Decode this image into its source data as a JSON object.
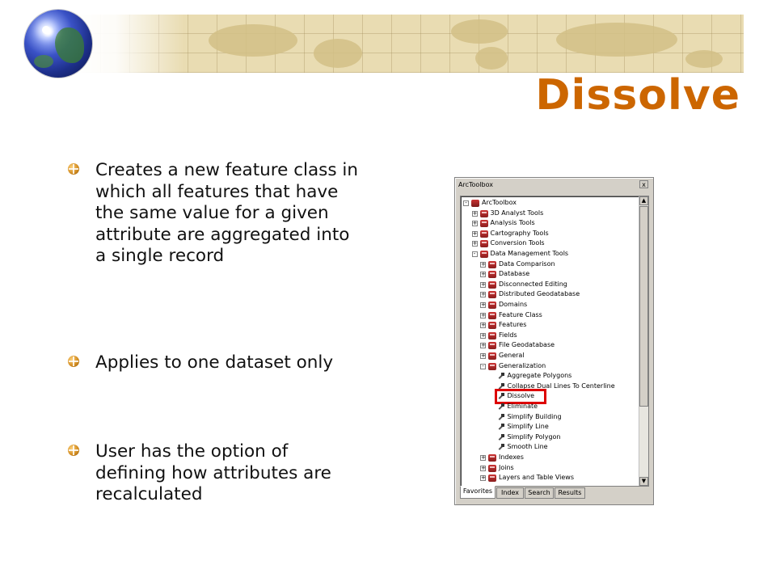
{
  "slide": {
    "title": "Dissolve",
    "bullets": [
      "Creates a new feature class in which all features that have the same value for a given attribute are aggregated into a single record",
      "Applies to one dataset only",
      "User has the option of defining how attributes are recalculated"
    ]
  },
  "window": {
    "title": "ArcToolbox",
    "close_label": "x",
    "tree": [
      {
        "label": "ArcToolbox",
        "level": 0,
        "icon": "toolbox-root-icon",
        "expander": "-"
      },
      {
        "label": "3D Analyst Tools",
        "level": 1,
        "icon": "toolbox-icon",
        "expander": "+"
      },
      {
        "label": "Analysis Tools",
        "level": 1,
        "icon": "toolbox-icon",
        "expander": "+"
      },
      {
        "label": "Cartography Tools",
        "level": 1,
        "icon": "toolbox-icon",
        "expander": "+"
      },
      {
        "label": "Conversion Tools",
        "level": 1,
        "icon": "toolbox-icon",
        "expander": "+"
      },
      {
        "label": "Data Management Tools",
        "level": 1,
        "icon": "toolbox-icon",
        "expander": "-"
      },
      {
        "label": "Data Comparison",
        "level": 2,
        "icon": "toolset-icon",
        "expander": "+"
      },
      {
        "label": "Database",
        "level": 2,
        "icon": "toolset-icon",
        "expander": "+"
      },
      {
        "label": "Disconnected Editing",
        "level": 2,
        "icon": "toolset-icon",
        "expander": "+"
      },
      {
        "label": "Distributed Geodatabase",
        "level": 2,
        "icon": "toolset-icon",
        "expander": "+"
      },
      {
        "label": "Domains",
        "level": 2,
        "icon": "toolset-icon",
        "expander": "+"
      },
      {
        "label": "Feature Class",
        "level": 2,
        "icon": "toolset-icon",
        "expander": "+"
      },
      {
        "label": "Features",
        "level": 2,
        "icon": "toolset-icon",
        "expander": "+"
      },
      {
        "label": "Fields",
        "level": 2,
        "icon": "toolset-icon",
        "expander": "+"
      },
      {
        "label": "File Geodatabase",
        "level": 2,
        "icon": "toolset-icon",
        "expander": "+"
      },
      {
        "label": "General",
        "level": 2,
        "icon": "toolset-icon",
        "expander": "+"
      },
      {
        "label": "Generalization",
        "level": 2,
        "icon": "toolset-icon",
        "expander": "-"
      },
      {
        "label": "Aggregate Polygons",
        "level": 3,
        "icon": "tool-hammer-icon",
        "expander": ""
      },
      {
        "label": "Collapse Dual Lines To Centerline",
        "level": 3,
        "icon": "tool-hammer-icon",
        "expander": ""
      },
      {
        "label": "Dissolve",
        "level": 3,
        "icon": "tool-hammer-icon",
        "expander": ""
      },
      {
        "label": "Eliminate",
        "level": 3,
        "icon": "tool-hammer-icon",
        "expander": ""
      },
      {
        "label": "Simplify Building",
        "level": 3,
        "icon": "tool-hammer-icon",
        "expander": ""
      },
      {
        "label": "Simplify Line",
        "level": 3,
        "icon": "tool-hammer-icon",
        "expander": ""
      },
      {
        "label": "Simplify Polygon",
        "level": 3,
        "icon": "tool-hammer-icon",
        "expander": ""
      },
      {
        "label": "Smooth Line",
        "level": 3,
        "icon": "tool-hammer-icon",
        "expander": ""
      },
      {
        "label": "Indexes",
        "level": 2,
        "icon": "toolset-icon",
        "expander": "+"
      },
      {
        "label": "Joins",
        "level": 2,
        "icon": "toolset-icon",
        "expander": "+"
      },
      {
        "label": "Layers and Table Views",
        "level": 2,
        "icon": "toolset-icon",
        "expander": "+"
      }
    ],
    "highlighted_item": "Dissolve",
    "highlight_color": "#dd0000",
    "tabs": [
      "Favorites",
      "Index",
      "Search",
      "Results"
    ],
    "active_tab": "Favorites"
  },
  "colors": {
    "title": "#cc6600",
    "band": "#e9dcb2"
  }
}
